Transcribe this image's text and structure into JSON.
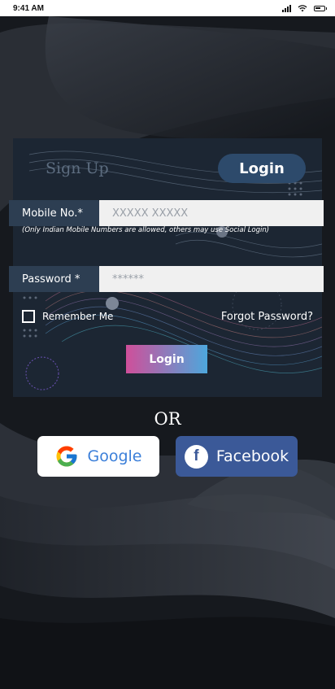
{
  "status_bar": {
    "time": "9:41 AM"
  },
  "tabs": {
    "signup": "Sign Up",
    "login": "Login"
  },
  "form": {
    "mobile_label": "Mobile No.*",
    "mobile_placeholder": "XXXXX XXXXX",
    "mobile_hint": "(Only Indian Mobile Numbers are allowed, others may use Social Login)",
    "password_label": "Password *",
    "password_placeholder": "******",
    "remember_label": "Remember Me",
    "forgot_label": "Forgot Password?",
    "login_button": "Login"
  },
  "separator": "OR",
  "social": {
    "google_label": "Google",
    "facebook_label": "Facebook"
  },
  "colors": {
    "card": "#1c2633",
    "login_tab": "#2d4a6b",
    "facebook": "#3b5998",
    "gradient_start": "#cf4f9a",
    "gradient_end": "#4da7dc"
  }
}
